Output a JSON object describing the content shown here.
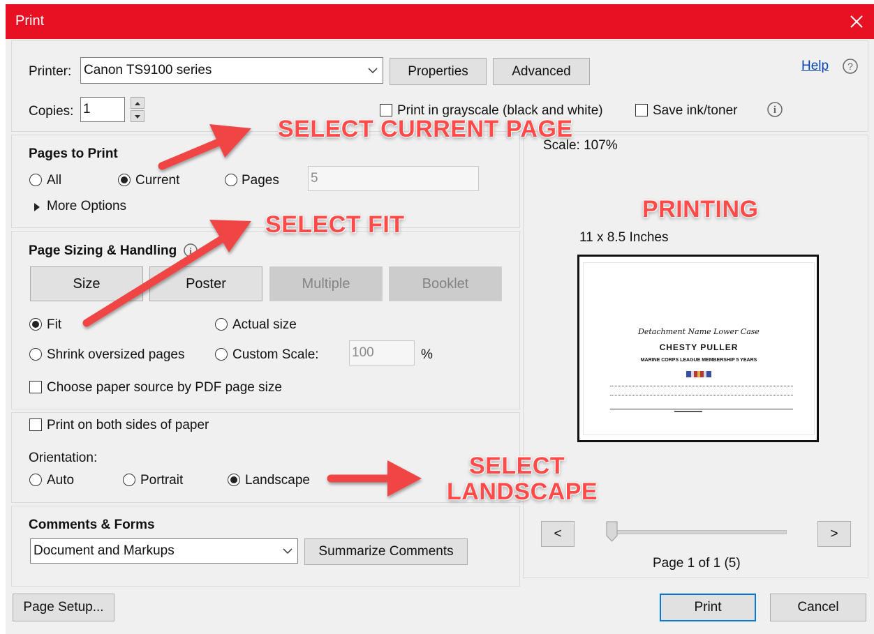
{
  "window": {
    "title": "Print",
    "close_icon": "close-icon"
  },
  "printer": {
    "label": "Printer:",
    "selected": "Canon TS9100 series",
    "properties_label": "Properties",
    "advanced_label": "Advanced",
    "help_label": "Help",
    "copies_label": "Copies:",
    "copies_value": "1",
    "grayscale_label": "Print in grayscale (black and white)",
    "grayscale_checked": false,
    "save_ink_label": "Save ink/toner",
    "save_ink_checked": false
  },
  "pages_to_print": {
    "heading": "Pages to Print",
    "all_label": "All",
    "current_label": "Current",
    "pages_label": "Pages",
    "pages_value": "5",
    "selected": "current",
    "more_options_label": "More Options"
  },
  "page_sizing": {
    "heading": "Page Sizing & Handling",
    "tabs": [
      {
        "label": "Size",
        "enabled": true
      },
      {
        "label": "Poster",
        "enabled": true
      },
      {
        "label": "Multiple",
        "enabled": false
      },
      {
        "label": "Booklet",
        "enabled": false
      }
    ],
    "fit_label": "Fit",
    "actual_size_label": "Actual size",
    "shrink_label": "Shrink oversized pages",
    "custom_scale_label": "Custom Scale:",
    "custom_scale_value": "100",
    "percent_sign": "%",
    "selected": "fit",
    "paper_source_label": "Choose paper source by PDF page size",
    "paper_source_checked": false
  },
  "duplex": {
    "both_sides_label": "Print on both sides of paper",
    "both_sides_checked": false,
    "orientation_label": "Orientation:",
    "auto_label": "Auto",
    "portrait_label": "Portrait",
    "landscape_label": "Landscape",
    "selected": "landscape"
  },
  "comments_forms": {
    "heading": "Comments & Forms",
    "selected": "Document and Markups",
    "summarize_label": "Summarize Comments"
  },
  "preview": {
    "scale_text": "Scale: 107%",
    "paper_size_text": "11 x 8.5 Inches",
    "prev_label": "<",
    "next_label": ">",
    "page_text": "Page 1 of 1 (5)",
    "slider_position": 0,
    "doc_line1": "Detachment Name Lower Case",
    "doc_line2": "CHESTY PULLER",
    "doc_line3": "MARINE CORPS LEAGUE MEMBERSHIP 5 YEARS"
  },
  "footer": {
    "page_setup_label": "Page Setup...",
    "print_label": "Print",
    "cancel_label": "Cancel"
  },
  "annotations": {
    "current_page": "SELECT CURRENT PAGE",
    "fit": "SELECT FIT",
    "printing": "PRINTING",
    "landscape_line1": "SELECT",
    "landscape_line2": "LANDSCAPE",
    "color": "#ff4a4a"
  },
  "colors": {
    "titlebar": "#e81123",
    "link": "#0645ad",
    "primary_border": "#0078d7"
  }
}
